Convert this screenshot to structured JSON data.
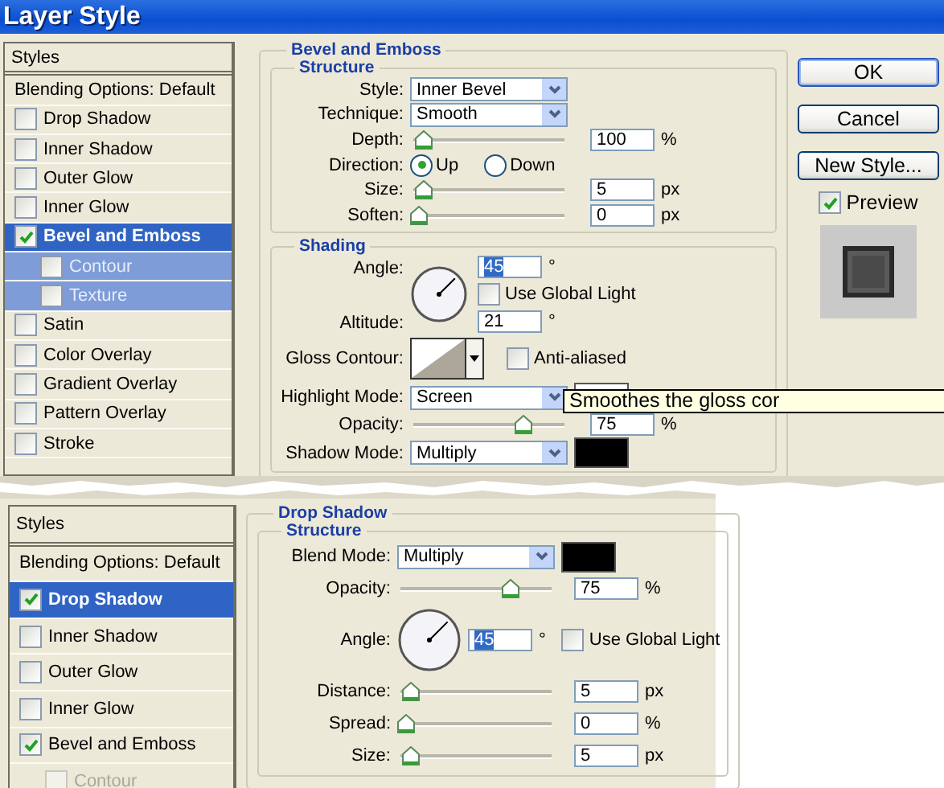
{
  "window": {
    "title": "Layer Style"
  },
  "dialogs": [
    {
      "styles_list": {
        "header": "Styles",
        "items": [
          {
            "kind": "plain",
            "label": "Blending Options: Default",
            "selected": false
          },
          {
            "kind": "check",
            "label": "Drop Shadow",
            "checked": false,
            "selected": false
          },
          {
            "kind": "check",
            "label": "Inner Shadow",
            "checked": false,
            "selected": false
          },
          {
            "kind": "check",
            "label": "Outer Glow",
            "checked": false,
            "selected": false
          },
          {
            "kind": "check",
            "label": "Inner Glow",
            "checked": false,
            "selected": false
          },
          {
            "kind": "check",
            "label": "Bevel and Emboss",
            "checked": true,
            "selected": true,
            "children": [
              {
                "label": "Contour",
                "checked": false,
                "disabled": false
              },
              {
                "label": "Texture",
                "checked": false,
                "disabled": false
              }
            ]
          },
          {
            "kind": "check",
            "label": "Satin",
            "checked": false,
            "selected": false
          },
          {
            "kind": "check",
            "label": "Color Overlay",
            "checked": false,
            "selected": false
          },
          {
            "kind": "check",
            "label": "Gradient Overlay",
            "checked": false,
            "selected": false
          },
          {
            "kind": "check",
            "label": "Pattern Overlay",
            "checked": false,
            "selected": false
          },
          {
            "kind": "check",
            "label": "Stroke",
            "checked": false,
            "selected": false
          }
        ]
      },
      "panel": {
        "title": "Bevel and Emboss",
        "groups": [
          {
            "title": "Structure",
            "rows": [
              {
                "kind": "select",
                "label": "Style:",
                "value": "Inner Bevel"
              },
              {
                "kind": "select",
                "label": "Technique:",
                "value": "Smooth"
              },
              {
                "kind": "slider",
                "label": "Depth:",
                "level": 0.03,
                "value": "100",
                "unit": "%"
              },
              {
                "kind": "radio",
                "label": "Direction:",
                "options": [
                  {
                    "label": "Up",
                    "selected": true
                  },
                  {
                    "label": "Down",
                    "selected": false
                  }
                ]
              },
              {
                "kind": "slider",
                "label": "Size:",
                "level": 0.03,
                "value": "5",
                "unit": "px"
              },
              {
                "kind": "slider",
                "label": "Soften:",
                "level": 0,
                "value": "0",
                "unit": "px"
              }
            ]
          },
          {
            "title": "Shading",
            "rows": [
              {
                "kind": "angle",
                "label": "Angle:",
                "value": "45",
                "unit": "°",
                "text_selected": true,
                "checkbox": {
                  "label": "Use Global Light",
                  "checked": false
                },
                "altitude": {
                  "label": "Altitude:",
                  "value": "21",
                  "unit": "°"
                }
              },
              {
                "kind": "contour",
                "label": "Gloss Contour:",
                "checkbox": {
                  "label": "Anti-aliased",
                  "checked": false
                }
              },
              {
                "kind": "select",
                "label": "Highlight Mode:",
                "value": "Screen",
                "color": "#ffffff"
              },
              {
                "kind": "slider",
                "label": "Opacity:",
                "level": 0.75,
                "value": "75",
                "unit": "%"
              },
              {
                "kind": "select",
                "label": "Shadow Mode:",
                "value": "Multiply",
                "color": "#000000"
              }
            ]
          }
        ]
      },
      "tooltip": "Smoothes the gloss cor",
      "buttons": [
        {
          "label": "OK",
          "default": true
        },
        {
          "label": "Cancel",
          "default": false
        },
        {
          "label": "New Style...",
          "default": false
        }
      ],
      "preview": {
        "label": "Preview",
        "checked": true
      }
    },
    {
      "styles_list": {
        "header": "Styles",
        "items": [
          {
            "kind": "plain",
            "label": "Blending Options: Default",
            "selected": false
          },
          {
            "kind": "check",
            "label": "Drop Shadow",
            "checked": true,
            "selected": true
          },
          {
            "kind": "check",
            "label": "Inner Shadow",
            "checked": false,
            "selected": false
          },
          {
            "kind": "check",
            "label": "Outer Glow",
            "checked": false,
            "selected": false
          },
          {
            "kind": "check",
            "label": "Inner Glow",
            "checked": false,
            "selected": false
          },
          {
            "kind": "check",
            "label": "Bevel and Emboss",
            "checked": true,
            "selected": false,
            "children": [
              {
                "label": "Contour",
                "checked": false,
                "disabled": true
              }
            ]
          }
        ]
      },
      "panel": {
        "title": "Drop Shadow",
        "groups": [
          {
            "title": "Structure",
            "rows": [
              {
                "kind": "select",
                "label": "Blend Mode:",
                "value": "Multiply",
                "color": "#000000"
              },
              {
                "kind": "slider",
                "label": "Opacity:",
                "level": 0.75,
                "value": "75",
                "unit": "%"
              },
              {
                "kind": "angle",
                "label": "Angle:",
                "value": "45",
                "unit": "°",
                "text_selected": true,
                "checkbox": {
                  "label": "Use Global Light",
                  "checked": false
                }
              },
              {
                "kind": "slider",
                "label": "Distance:",
                "level": 0.03,
                "value": "5",
                "unit": "px"
              },
              {
                "kind": "slider",
                "label": "Spread:",
                "level": 0,
                "value": "0",
                "unit": "%"
              },
              {
                "kind": "slider",
                "label": "Size:",
                "level": 0.03,
                "value": "5",
                "unit": "px"
              }
            ]
          }
        ]
      }
    }
  ]
}
